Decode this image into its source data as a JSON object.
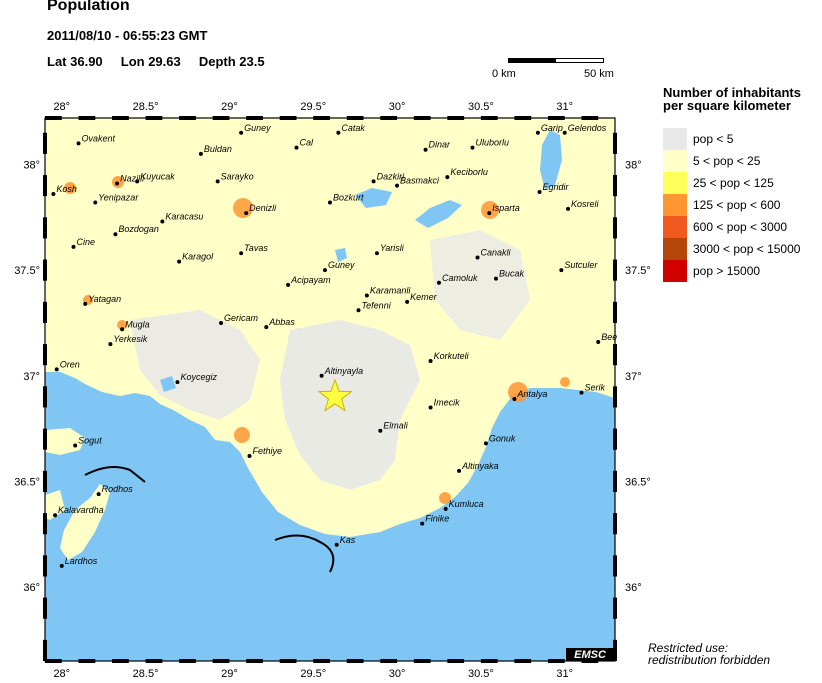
{
  "header": {
    "title": "Population",
    "datetime": "2011/08/10 - 06:55:23 GMT",
    "lat_label": "Lat",
    "lat": "36.90",
    "lon_label": "Lon",
    "lon": "29.63",
    "depth_label": "Depth",
    "depth": "23.5"
  },
  "scale_bar": {
    "left_label": "0 km",
    "right_label": "50 km"
  },
  "legend": {
    "title_line1": "Number of inhabitants",
    "title_line2": "per square kilometer",
    "items": [
      {
        "label": "pop < 5",
        "color": "#e8e8e8"
      },
      {
        "label": "5 < pop < 25",
        "color": "#ffffc8"
      },
      {
        "label": "25 < pop < 125",
        "color": "#ffff5a"
      },
      {
        "label": "125 < pop < 600",
        "color": "#ff9632"
      },
      {
        "label": "600 < pop < 3000",
        "color": "#f05a1e"
      },
      {
        "label": "3000 < pop < 15000",
        "color": "#b4460a"
      },
      {
        "label": "pop > 15000",
        "color": "#d20000"
      }
    ]
  },
  "restriction": {
    "line1": "Restricted use:",
    "line2": "redistribution forbidden"
  },
  "logo": "EMSC",
  "colors": {
    "sea": "#7fc6f5",
    "land_sparse": "#e8e8e8",
    "land": "#ffffc8",
    "urban": "#ff9632",
    "epicenter": "#ffff40"
  },
  "map": {
    "lon_range": [
      27.9,
      31.3
    ],
    "lat_range": [
      35.65,
      38.22
    ],
    "x_ticks": [
      {
        "value": 28,
        "label": "28°"
      },
      {
        "value": 28.5,
        "label": "28.5°"
      },
      {
        "value": 29,
        "label": "29°"
      },
      {
        "value": 29.5,
        "label": "29.5°"
      },
      {
        "value": 30,
        "label": "30°"
      },
      {
        "value": 30.5,
        "label": "30.5°"
      },
      {
        "value": 31,
        "label": "31°"
      }
    ],
    "y_ticks": [
      {
        "value": 36,
        "label": "36°"
      },
      {
        "value": 36.5,
        "label": "36.5°"
      },
      {
        "value": 37,
        "label": "37°"
      },
      {
        "value": 37.5,
        "label": "37.5°"
      },
      {
        "value": 38,
        "label": "38°"
      }
    ],
    "epicenter": {
      "lon": 29.63,
      "lat": 36.9
    },
    "cities": [
      {
        "name": "Ovakent",
        "lon": 28.1,
        "lat": 38.1
      },
      {
        "name": "Guney",
        "lon": 29.07,
        "lat": 38.15
      },
      {
        "name": "Cal",
        "lon": 29.4,
        "lat": 38.08
      },
      {
        "name": "Catak",
        "lon": 29.65,
        "lat": 38.15
      },
      {
        "name": "Dinar",
        "lon": 30.17,
        "lat": 38.07
      },
      {
        "name": "Uluborlu",
        "lon": 30.45,
        "lat": 38.08
      },
      {
        "name": "Garip",
        "lon": 30.84,
        "lat": 38.15
      },
      {
        "name": "Gelendos",
        "lon": 31.0,
        "lat": 38.15
      },
      {
        "name": "Buldan",
        "lon": 28.83,
        "lat": 38.05
      },
      {
        "name": "Nazilli",
        "lon": 28.33,
        "lat": 37.91
      },
      {
        "name": "Kuyucak",
        "lon": 28.45,
        "lat": 37.92
      },
      {
        "name": "Sarayko",
        "lon": 28.93,
        "lat": 37.92
      },
      {
        "name": "Dazkiri",
        "lon": 29.86,
        "lat": 37.92
      },
      {
        "name": "Basmakci",
        "lon": 30.0,
        "lat": 37.9
      },
      {
        "name": "Keciborlu",
        "lon": 30.3,
        "lat": 37.94
      },
      {
        "name": "Kosh",
        "lon": 27.95,
        "lat": 37.86
      },
      {
        "name": "Yenipazar",
        "lon": 28.2,
        "lat": 37.82
      },
      {
        "name": "Bozkurt",
        "lon": 29.6,
        "lat": 37.82
      },
      {
        "name": "Egridir",
        "lon": 30.85,
        "lat": 37.87
      },
      {
        "name": "Denizli",
        "lon": 29.1,
        "lat": 37.77
      },
      {
        "name": "Isparta",
        "lon": 30.55,
        "lat": 37.77
      },
      {
        "name": "Kosreli",
        "lon": 31.02,
        "lat": 37.79
      },
      {
        "name": "Karacasu",
        "lon": 28.6,
        "lat": 37.73
      },
      {
        "name": "Bozdogan",
        "lon": 28.32,
        "lat": 37.67
      },
      {
        "name": "Cine",
        "lon": 28.07,
        "lat": 37.61
      },
      {
        "name": "Tavas",
        "lon": 29.07,
        "lat": 37.58
      },
      {
        "name": "Yarisli",
        "lon": 29.88,
        "lat": 37.58
      },
      {
        "name": "Canakli",
        "lon": 30.48,
        "lat": 37.56
      },
      {
        "name": "Karagol",
        "lon": 28.7,
        "lat": 37.54
      },
      {
        "name": "Guney",
        "lon": 29.57,
        "lat": 37.5
      },
      {
        "name": "Sutculer",
        "lon": 30.98,
        "lat": 37.5
      },
      {
        "name": "Karamanli",
        "lon": 29.82,
        "lat": 37.38
      },
      {
        "name": "Camoluk",
        "lon": 30.25,
        "lat": 37.44
      },
      {
        "name": "Bucak",
        "lon": 30.59,
        "lat": 37.46
      },
      {
        "name": "Acipayam",
        "lon": 29.35,
        "lat": 37.43
      },
      {
        "name": "Kemer",
        "lon": 30.06,
        "lat": 37.35
      },
      {
        "name": "Tefenni",
        "lon": 29.77,
        "lat": 37.31
      },
      {
        "name": "Yatagan",
        "lon": 28.14,
        "lat": 37.34
      },
      {
        "name": "Gericam",
        "lon": 28.95,
        "lat": 37.25
      },
      {
        "name": "Abbas",
        "lon": 29.22,
        "lat": 37.23
      },
      {
        "name": "Mugla",
        "lon": 28.36,
        "lat": 37.22
      },
      {
        "name": "Yerkesik",
        "lon": 28.29,
        "lat": 37.15
      },
      {
        "name": "Bee",
        "lon": 31.2,
        "lat": 37.16
      },
      {
        "name": "Korkuteli",
        "lon": 30.2,
        "lat": 37.07
      },
      {
        "name": "Oren",
        "lon": 27.97,
        "lat": 37.03
      },
      {
        "name": "Altinyayla",
        "lon": 29.55,
        "lat": 37.0
      },
      {
        "name": "Koycegiz",
        "lon": 28.69,
        "lat": 36.97
      },
      {
        "name": "Serik",
        "lon": 31.1,
        "lat": 36.92
      },
      {
        "name": "Antalya",
        "lon": 30.7,
        "lat": 36.89
      },
      {
        "name": "Imecik",
        "lon": 30.2,
        "lat": 36.85
      },
      {
        "name": "Elmali",
        "lon": 29.9,
        "lat": 36.74
      },
      {
        "name": "Sogut",
        "lon": 28.08,
        "lat": 36.67
      },
      {
        "name": "Gonuk",
        "lon": 30.53,
        "lat": 36.68
      },
      {
        "name": "Fethiye",
        "lon": 29.12,
        "lat": 36.62
      },
      {
        "name": "Altinyaka",
        "lon": 30.37,
        "lat": 36.55
      },
      {
        "name": "Rodhos",
        "lon": 28.22,
        "lat": 36.44
      },
      {
        "name": "Kalavardha",
        "lon": 27.96,
        "lat": 36.34
      },
      {
        "name": "Kumluca",
        "lon": 30.29,
        "lat": 36.37
      },
      {
        "name": "Finike",
        "lon": 30.15,
        "lat": 36.3
      },
      {
        "name": "Kas",
        "lon": 29.64,
        "lat": 36.2
      },
      {
        "name": "Lardhos",
        "lon": 28.0,
        "lat": 36.1
      }
    ]
  }
}
